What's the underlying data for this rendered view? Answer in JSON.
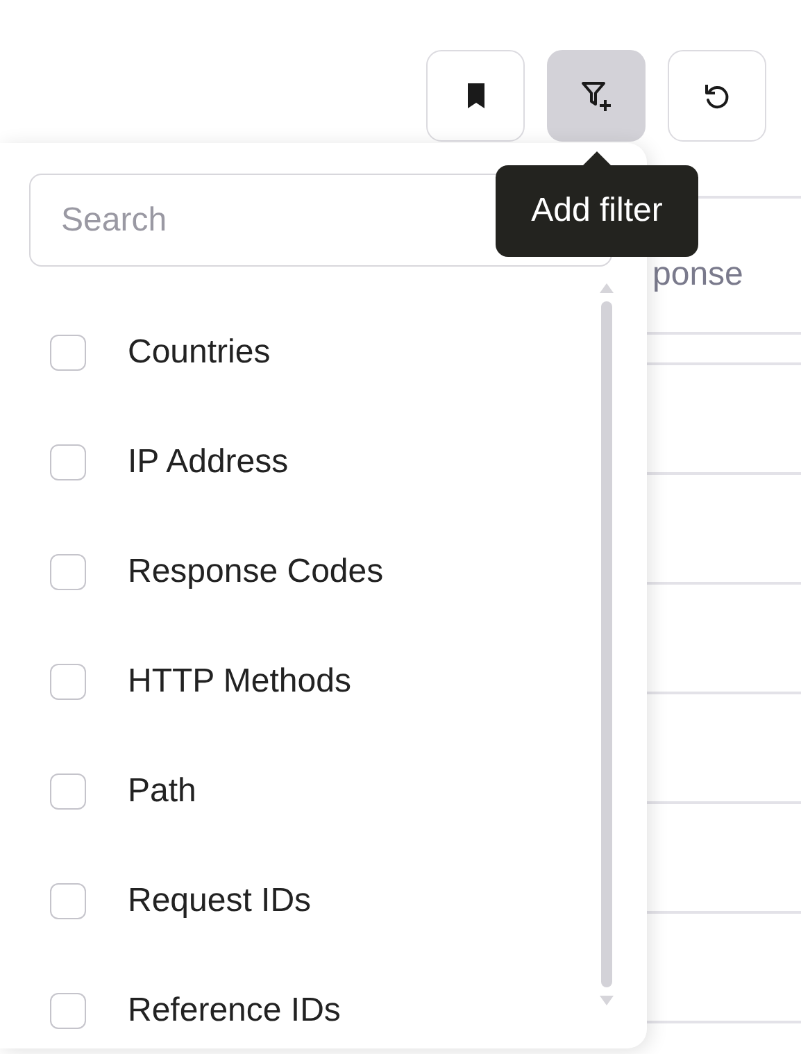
{
  "toolbar": {
    "buttons": [
      {
        "kind": "bookmark",
        "selected": false
      },
      {
        "kind": "add-filter",
        "selected": true
      },
      {
        "kind": "refresh",
        "selected": false
      }
    ]
  },
  "tooltip": {
    "text": "Add filter"
  },
  "table": {
    "columns": [
      {
        "label": "ponse"
      }
    ]
  },
  "filter_menu": {
    "search": {
      "placeholder": "Search"
    },
    "items": [
      {
        "label": "Countries",
        "checked": false
      },
      {
        "label": "IP Address",
        "checked": false
      },
      {
        "label": "Response Codes",
        "checked": false
      },
      {
        "label": "HTTP Methods",
        "checked": false
      },
      {
        "label": "Path",
        "checked": false
      },
      {
        "label": "Request IDs",
        "checked": false
      },
      {
        "label": "Reference IDs",
        "checked": false
      }
    ]
  }
}
